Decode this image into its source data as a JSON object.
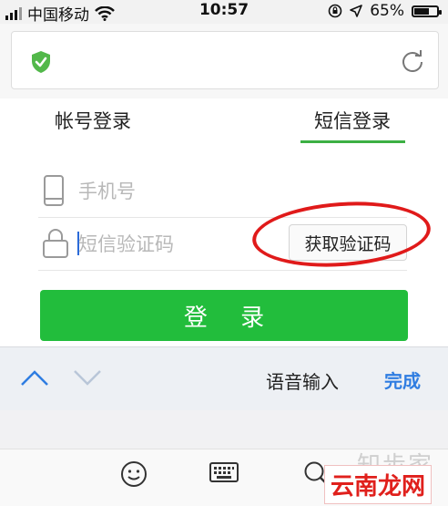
{
  "status_bar": {
    "carrier": "中国移动",
    "time": "10:57",
    "battery_text": "65%",
    "battery_level": 0.65
  },
  "address_bar": {
    "security_icon": "shield-check-icon",
    "reload_icon": "reload-icon"
  },
  "tabs": {
    "account": "帐号登录",
    "sms": "短信登录",
    "active": "sms"
  },
  "form": {
    "phone_placeholder": "手机号",
    "code_placeholder": "短信验证码",
    "get_code_button": "获取验证码",
    "login_button": "登 录"
  },
  "keyboard_toolbar": {
    "voice_input": "语音输入",
    "done": "完成"
  },
  "watermarks": {
    "top": "知步家",
    "bottom": "云南龙网"
  },
  "colors": {
    "accent_green": "#22bd3c",
    "tab_underline": "#3cb043",
    "done_blue": "#2f7de1",
    "annotation_red": "#e01a1a"
  }
}
